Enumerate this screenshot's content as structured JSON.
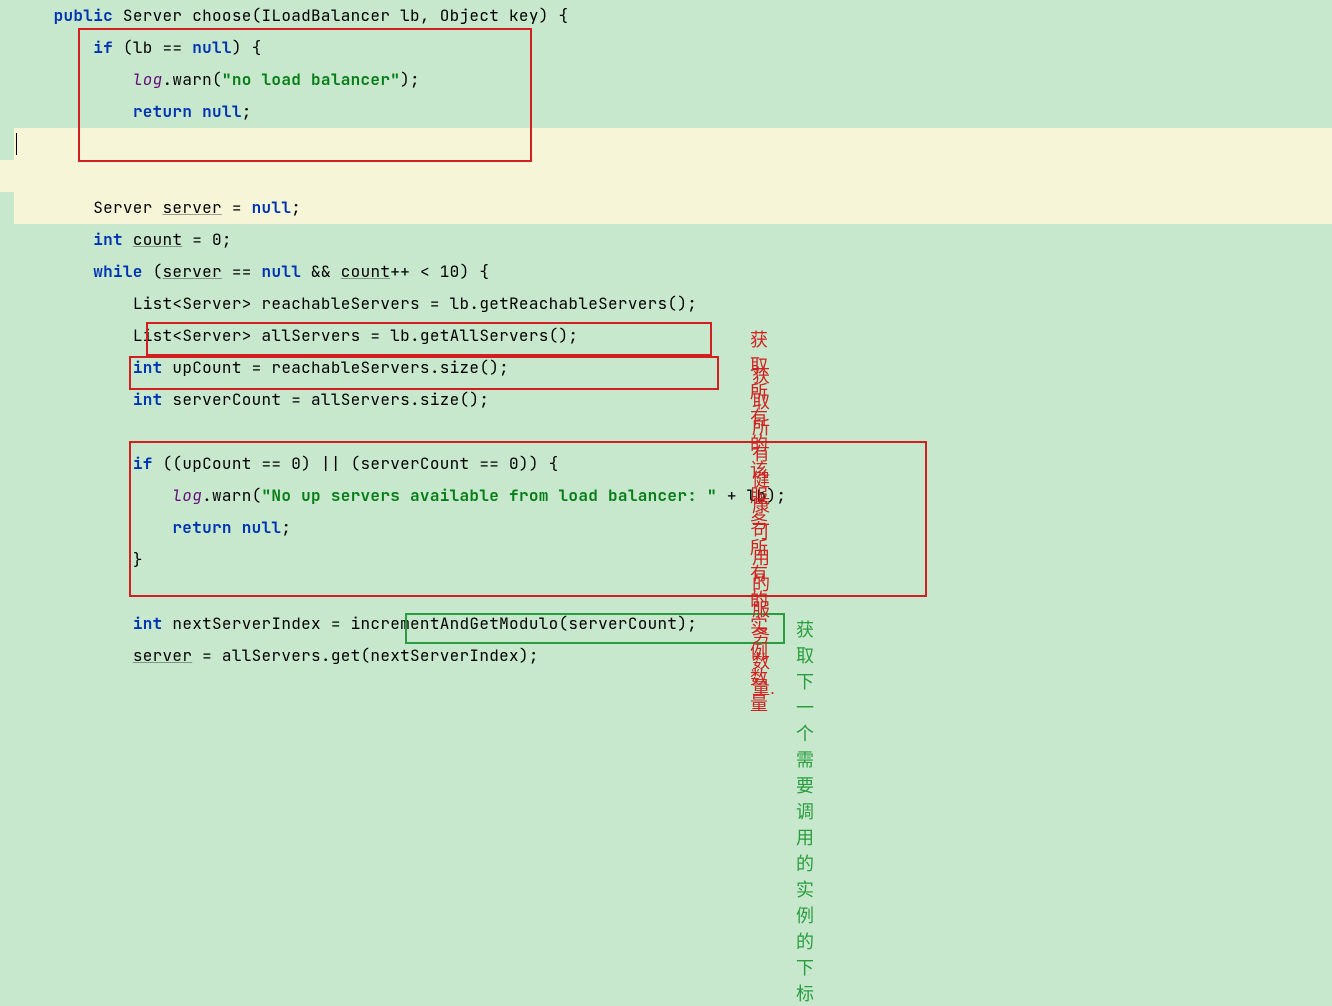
{
  "code": {
    "l1": {
      "kw1": "public",
      "t1": " Server choose(ILoadBalancer lb, Object key) {"
    },
    "l2": {
      "kw1": "if",
      "t1": " (lb == ",
      "kw2": "null",
      "t2": ") {"
    },
    "l3": {
      "f1": "log",
      "t1": ".warn(",
      "s1": "\"no load balancer\"",
      "t2": ");"
    },
    "l4": {
      "kw1": "return null",
      "t1": ";"
    },
    "l5": {
      "t1": "}"
    },
    "l7": {
      "t1": "Server ",
      "u1": "server",
      "t2": " = ",
      "kw1": "null",
      "t3": ";"
    },
    "l8": {
      "kw1": "int",
      "t1": " ",
      "u1": "count",
      "t2": " = 0;"
    },
    "l9": {
      "kw1": "while",
      "t1": " (",
      "u1": "server",
      "t2": " == ",
      "kw2": "null",
      "t3": " && ",
      "u2": "count",
      "t4": "++ < 10) {"
    },
    "l10": {
      "t1": "List<Server> reachableServers = lb.getReachableServers();"
    },
    "l11": {
      "t1": "List<Server> allServers = lb.getAllServers();"
    },
    "l12": {
      "kw1": "int",
      "t1": " upCount = reachableServers.size();"
    },
    "l13": {
      "kw1": "int",
      "t1": " serverCount = allServers.size();"
    },
    "l15": {
      "kw1": "if",
      "t1": " ((upCount == 0) || (serverCount == 0)) {"
    },
    "l16": {
      "f1": "log",
      "t1": ".warn(",
      "s1": "\"No up servers available from load balancer: \"",
      "t2": " + lb);"
    },
    "l17": {
      "kw1": "return null",
      "t1": ";"
    },
    "l18": {
      "t1": "}"
    },
    "l20": {
      "kw1": "int",
      "t1": " nextServerIndex = incrementAndGetModulo(serverCount);"
    },
    "l21": {
      "u1": "server",
      "t1": " = allServers.get(nextServerIndex);"
    }
  },
  "annotations": {
    "a1": "获取所有的该服务所有的实例数量",
    "a2": "获取所有健康可用的服务数量.",
    "a3": "获取下一个需要调用的实例的下标"
  }
}
